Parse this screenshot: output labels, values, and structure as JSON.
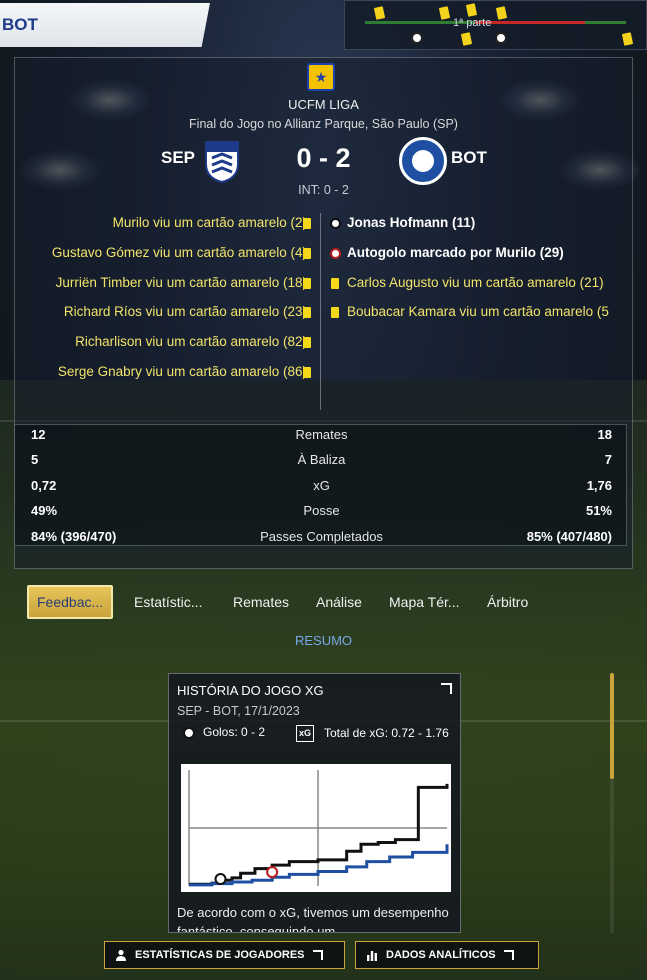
{
  "top_bar": {
    "team_tab": "BOT",
    "timeline_label": "1ª parte"
  },
  "match": {
    "league": "UCFM LIGA",
    "venue": "Final do Jogo no Allianz Parque, São Paulo (SP)",
    "home_code": "SEP",
    "away_code": "BOT",
    "score": "0 - 2",
    "half_time": "INT: 0 - 2"
  },
  "events": {
    "home": [
      "Murilo viu um cartão amarelo (2)",
      "Gustavo Gómez viu um cartão amarelo (4)",
      "Jurriën Timber viu um cartão amarelo (18)",
      "Richard Ríos viu um cartão amarelo (23)",
      "Richarlison viu um cartão amarelo (82)",
      "Serge Gnabry viu um cartão amarelo (86)"
    ],
    "away": [
      {
        "text": "Jonas Hofmann (11)",
        "kind": "goal"
      },
      {
        "text": "Autogolo marcado por Murilo (29)",
        "kind": "own-goal"
      },
      {
        "text": "Carlos Augusto viu um cartão amarelo (21)",
        "kind": "card"
      },
      {
        "text": "Boubacar Kamara viu um cartão amarelo (5",
        "kind": "card"
      }
    ]
  },
  "stats": [
    {
      "label": "Remates",
      "home": "12",
      "away": "18"
    },
    {
      "label": "À Baliza",
      "home": "5",
      "away": "7"
    },
    {
      "label": "xG",
      "home": "0,72",
      "away": "1,76"
    },
    {
      "label": "Posse",
      "home": "49%",
      "away": "51%"
    },
    {
      "label": "Passes Completados",
      "home": "84% (396/470)",
      "away": "85% (407/480)"
    }
  ],
  "tabs": [
    "Feedbac...",
    "Estatístic...",
    "Remates",
    "Análise",
    "Mapa Tér...",
    "Árbitro"
  ],
  "section_label": "RESUMO",
  "xg_card": {
    "title": "HISTÓRIA DO JOGO XG",
    "subtitle": "SEP - BOT, 17/1/2023",
    "goals": "Golos: 0 - 2",
    "total": "Total de xG: 0.72 - 1.76",
    "xg_icon": "xG",
    "text": "De acordo com o xG, tivemos um desempenho fantástico, conseguindo um"
  },
  "chart_data": {
    "type": "line",
    "series": [
      {
        "color": "#111111",
        "x": [
          0,
          8,
          11,
          15,
          18,
          23,
          29,
          35,
          45,
          55,
          60,
          66,
          72,
          80,
          90
        ],
        "y": [
          0.03,
          0.05,
          0.1,
          0.14,
          0.22,
          0.3,
          0.36,
          0.42,
          0.45,
          0.6,
          0.72,
          0.75,
          0.8,
          1.7,
          1.76
        ]
      },
      {
        "color": "#1e4fa3",
        "x": [
          0,
          8,
          15,
          22,
          29,
          35,
          45,
          55,
          62,
          70,
          78,
          90
        ],
        "y": [
          0.02,
          0.04,
          0.07,
          0.1,
          0.15,
          0.2,
          0.25,
          0.33,
          0.42,
          0.5,
          0.58,
          0.72
        ]
      }
    ],
    "goal_markers": [
      {
        "minute": 11,
        "kind": "goal"
      },
      {
        "minute": 29,
        "kind": "own-goal"
      }
    ],
    "half_time_minute": 45,
    "ylim": [
      0,
      2
    ],
    "grid": false
  },
  "bottom_buttons": {
    "player_stats": "ESTATÍSTICAS DE JOGADORES",
    "analytics": "DADOS ANALÍTICOS"
  },
  "colors": {
    "accent": "#c9a43a",
    "card": "#f6d81a",
    "link": "#7aa7e6"
  }
}
